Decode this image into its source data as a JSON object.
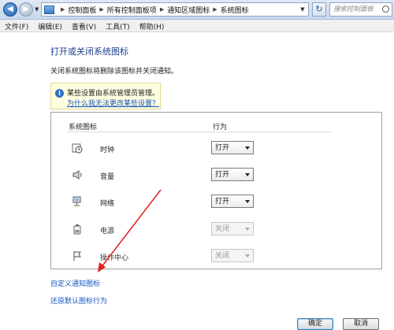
{
  "window": {
    "breadcrumbs": [
      "控制面板",
      "所有控制面板项",
      "通知区域图标",
      "系统图标"
    ],
    "search_placeholder": "搜索控制面板",
    "back_icon": "back-arrow-icon",
    "forward_icon": "forward-arrow-icon",
    "refresh_icon": "refresh-icon"
  },
  "menu": [
    "文件(F)",
    "编辑(E)",
    "查看(V)",
    "工具(T)",
    "帮助(H)"
  ],
  "page": {
    "title": "打开或关闭系统图标",
    "description": "关闭系统图标将删除该图标并关闭通知。"
  },
  "info": {
    "text": "某些设置由系统管理员管理。",
    "link": "为什么我无法更改某些设置？"
  },
  "table": {
    "col_icon": "系统图标",
    "col_behavior": "行为",
    "rows": [
      {
        "label": "时钟",
        "icon": "clock-icon",
        "value": "打开",
        "enabled": true
      },
      {
        "label": "音量",
        "icon": "volume-icon",
        "value": "打开",
        "enabled": true
      },
      {
        "label": "网络",
        "icon": "network-icon",
        "value": "打开",
        "enabled": true
      },
      {
        "label": "电源",
        "icon": "power-icon",
        "value": "关闭",
        "enabled": false
      },
      {
        "label": "操作中心",
        "icon": "flag-icon",
        "value": "关闭",
        "enabled": false
      }
    ]
  },
  "links": {
    "customize": "自定义通知图标",
    "restore": "还原默认图标行为"
  },
  "buttons": {
    "ok": "确定",
    "cancel": "取消"
  },
  "colors": {
    "link": "#1654c0",
    "title": "#1e3f8a",
    "annotation_arrow": "#e0201c"
  }
}
